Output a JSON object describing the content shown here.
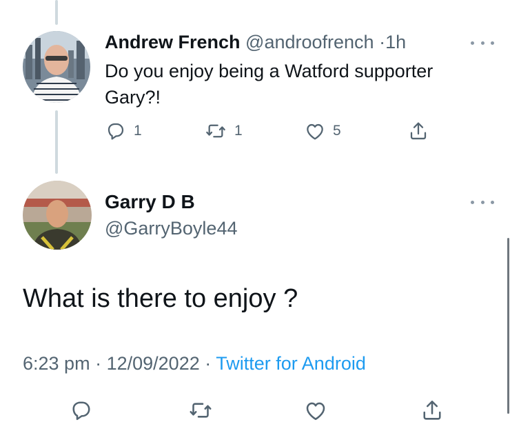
{
  "reply_tweet": {
    "author_name": "Andrew French",
    "handle": "@androofrench",
    "separator": "·",
    "time_ago": "1h",
    "text": "Do you enjoy being a Watford supporter Gary?!",
    "reply_count": "1",
    "retweet_count": "1",
    "like_count": "5"
  },
  "main_tweet": {
    "author_name": "Garry D B",
    "handle": "@GarryBoyle44",
    "text": "What is there to enjoy ?",
    "time": "6:23 pm",
    "separator": "·",
    "date": "12/09/2022",
    "source": "Twitter for Android"
  },
  "icons": [
    "reply-icon",
    "retweet-icon",
    "like-icon",
    "share-icon",
    "more-icon"
  ],
  "colors": {
    "text_primary": "#0f1419",
    "text_secondary": "#536471",
    "link": "#1d9bf0",
    "thread_line": "#cfd9de"
  }
}
